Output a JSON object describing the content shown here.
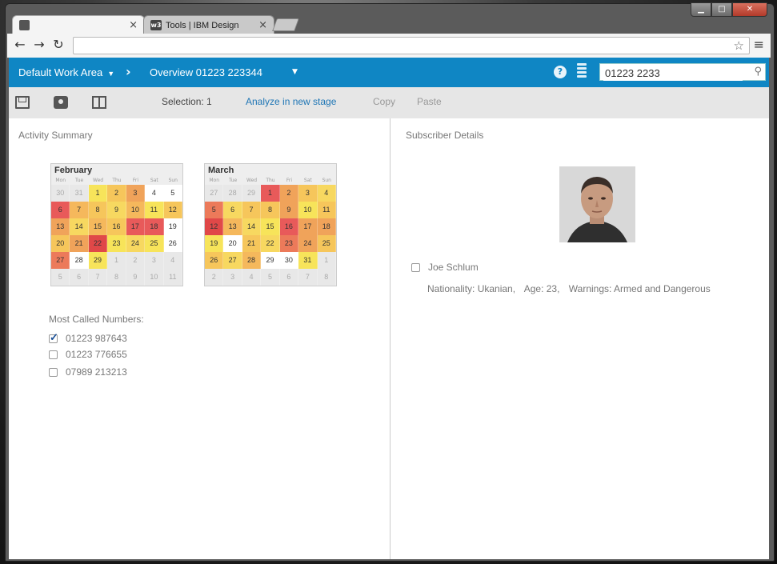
{
  "browser": {
    "tabs": [
      {
        "title": "",
        "close": "×"
      },
      {
        "title": "Tools | IBM Design",
        "favicon_text": "w3",
        "close": "×"
      }
    ],
    "url": "",
    "window_controls": {
      "min": "▁",
      "max": "□",
      "close": "✕"
    }
  },
  "topbar": {
    "work_area": "Default Work Area",
    "breadcrumb": "Overview 01223 223344",
    "help": "?",
    "search_value": "01223 2233"
  },
  "toolbar": {
    "selection": "Selection: 1",
    "analyze": "Analyze in new stage",
    "copy": "Copy",
    "paste": "Paste"
  },
  "activity": {
    "title": "Activity Summary",
    "weekdays": [
      "Mon",
      "Tue",
      "Wed",
      "Thu",
      "Fri",
      "Sat",
      "Sun"
    ],
    "calendars": [
      {
        "month": "February",
        "days": [
          {
            "d": "30",
            "c": "#e8e8e8",
            "dim": true
          },
          {
            "d": "31",
            "c": "#e8e8e8",
            "dim": true
          },
          {
            "d": "1",
            "c": "#f7e45a"
          },
          {
            "d": "2",
            "c": "#f6c65b"
          },
          {
            "d": "3",
            "c": "#f0a35a"
          },
          {
            "d": "4",
            "c": "#ffffff"
          },
          {
            "d": "5",
            "c": "#ffffff"
          },
          {
            "d": "6",
            "c": "#e85a5a"
          },
          {
            "d": "7",
            "c": "#f5b85c"
          },
          {
            "d": "8",
            "c": "#f6c65b"
          },
          {
            "d": "9",
            "c": "#f7d860"
          },
          {
            "d": "10",
            "c": "#f5b85c"
          },
          {
            "d": "11",
            "c": "#f7e45a"
          },
          {
            "d": "12",
            "c": "#f6c65b"
          },
          {
            "d": "13",
            "c": "#f0a35a"
          },
          {
            "d": "14",
            "c": "#f7d860"
          },
          {
            "d": "15",
            "c": "#f5b85c"
          },
          {
            "d": "16",
            "c": "#f6c65b"
          },
          {
            "d": "17",
            "c": "#e85a5a"
          },
          {
            "d": "18",
            "c": "#e85a5a"
          },
          {
            "d": "19",
            "c": "#ffffff"
          },
          {
            "d": "20",
            "c": "#f6c65b"
          },
          {
            "d": "21",
            "c": "#f0a35a"
          },
          {
            "d": "22",
            "c": "#e04848"
          },
          {
            "d": "23",
            "c": "#f7e45a"
          },
          {
            "d": "24",
            "c": "#f7d860"
          },
          {
            "d": "25",
            "c": "#f7e45a"
          },
          {
            "d": "26",
            "c": "#ffffff"
          },
          {
            "d": "27",
            "c": "#ec7a5a"
          },
          {
            "d": "28",
            "c": "#ffffff"
          },
          {
            "d": "29",
            "c": "#f7e45a"
          },
          {
            "d": "1",
            "c": "#e8e8e8",
            "dim": true
          },
          {
            "d": "2",
            "c": "#e8e8e8",
            "dim": true
          },
          {
            "d": "3",
            "c": "#e8e8e8",
            "dim": true
          },
          {
            "d": "4",
            "c": "#e8e8e8",
            "dim": true
          },
          {
            "d": "5",
            "c": "#e8e8e8",
            "dim": true
          },
          {
            "d": "6",
            "c": "#e8e8e8",
            "dim": true
          },
          {
            "d": "7",
            "c": "#e8e8e8",
            "dim": true
          },
          {
            "d": "8",
            "c": "#e8e8e8",
            "dim": true
          },
          {
            "d": "9",
            "c": "#e8e8e8",
            "dim": true
          },
          {
            "d": "10",
            "c": "#e8e8e8",
            "dim": true
          },
          {
            "d": "11",
            "c": "#e8e8e8",
            "dim": true
          }
        ]
      },
      {
        "month": "March",
        "days": [
          {
            "d": "27",
            "c": "#e8e8e8",
            "dim": true
          },
          {
            "d": "28",
            "c": "#e8e8e8",
            "dim": true
          },
          {
            "d": "29",
            "c": "#e8e8e8",
            "dim": true
          },
          {
            "d": "1",
            "c": "#e85a5a"
          },
          {
            "d": "2",
            "c": "#f0a35a"
          },
          {
            "d": "3",
            "c": "#f6c65b"
          },
          {
            "d": "4",
            "c": "#f7d860"
          },
          {
            "d": "5",
            "c": "#ec7a5a"
          },
          {
            "d": "6",
            "c": "#f7d860"
          },
          {
            "d": "7",
            "c": "#f6c65b"
          },
          {
            "d": "8",
            "c": "#f6c65b"
          },
          {
            "d": "9",
            "c": "#f0a35a"
          },
          {
            "d": "10",
            "c": "#f7e45a"
          },
          {
            "d": "11",
            "c": "#f6c65b"
          },
          {
            "d": "12",
            "c": "#e04848"
          },
          {
            "d": "13",
            "c": "#f5b85c"
          },
          {
            "d": "14",
            "c": "#f7d860"
          },
          {
            "d": "15",
            "c": "#f7e45a"
          },
          {
            "d": "16",
            "c": "#e85a5a"
          },
          {
            "d": "17",
            "c": "#f0a35a"
          },
          {
            "d": "18",
            "c": "#f0a35a"
          },
          {
            "d": "19",
            "c": "#f7e45a"
          },
          {
            "d": "20",
            "c": "#ffffff"
          },
          {
            "d": "21",
            "c": "#f6c65b"
          },
          {
            "d": "22",
            "c": "#f7d860"
          },
          {
            "d": "23",
            "c": "#ec7a5a"
          },
          {
            "d": "24",
            "c": "#f0a35a"
          },
          {
            "d": "25",
            "c": "#f6c65b"
          },
          {
            "d": "26",
            "c": "#f6c65b"
          },
          {
            "d": "27",
            "c": "#f7d860"
          },
          {
            "d": "28",
            "c": "#f5b85c"
          },
          {
            "d": "29",
            "c": "#ffffff"
          },
          {
            "d": "30",
            "c": "#ffffff"
          },
          {
            "d": "31",
            "c": "#f7e45a"
          },
          {
            "d": "1",
            "c": "#e8e8e8",
            "dim": true
          },
          {
            "d": "2",
            "c": "#e8e8e8",
            "dim": true
          },
          {
            "d": "3",
            "c": "#e8e8e8",
            "dim": true
          },
          {
            "d": "4",
            "c": "#e8e8e8",
            "dim": true
          },
          {
            "d": "5",
            "c": "#e8e8e8",
            "dim": true
          },
          {
            "d": "6",
            "c": "#e8e8e8",
            "dim": true
          },
          {
            "d": "7",
            "c": "#e8e8e8",
            "dim": true
          },
          {
            "d": "8",
            "c": "#e8e8e8",
            "dim": true
          }
        ]
      }
    ],
    "numbers_label": "Most Called Numbers:",
    "numbers": [
      {
        "value": "01223 987643",
        "checked": true
      },
      {
        "value": "01223 776655",
        "checked": false
      },
      {
        "value": "07989 213213",
        "checked": false
      }
    ]
  },
  "subscriber": {
    "title": "Subscriber Details",
    "name": "Joe Schlum",
    "nationality": "Nationality: Ukanian,",
    "age": "Age: 23,",
    "warnings": "Warnings: Armed and Dangerous"
  },
  "colors": {
    "accent": "#0f86c4",
    "link": "#1f76b5"
  }
}
